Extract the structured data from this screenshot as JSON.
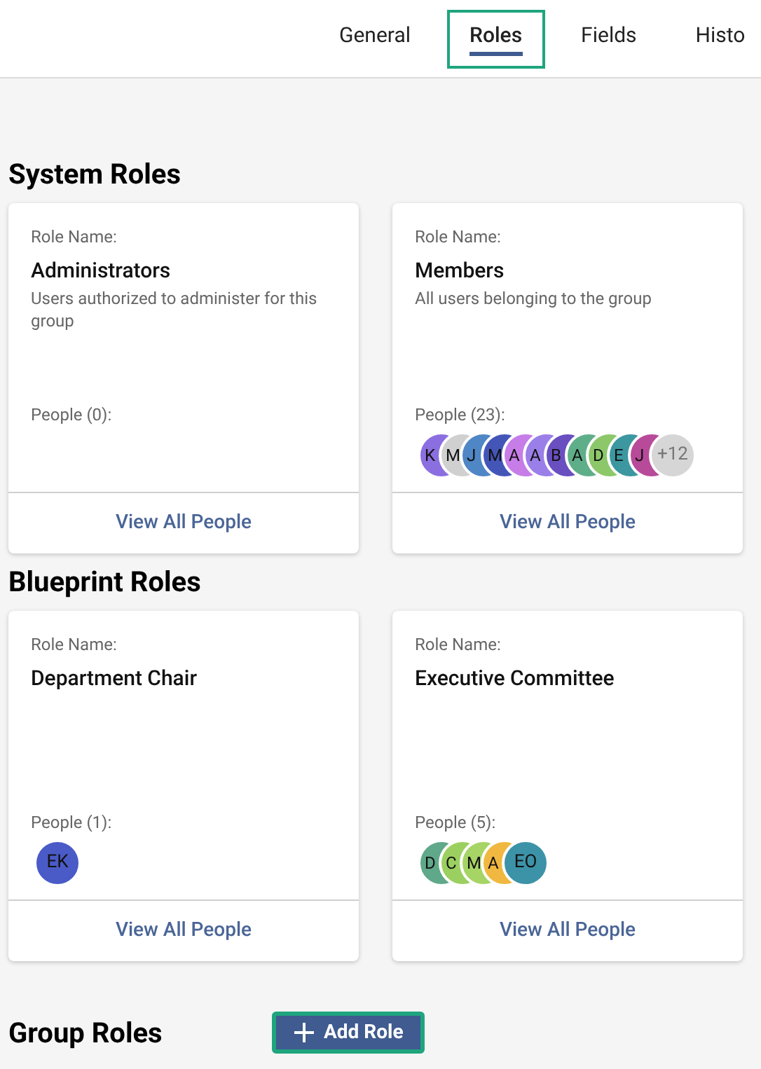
{
  "tabs": [
    {
      "label": "General",
      "selected": false,
      "focused": false
    },
    {
      "label": "Roles",
      "selected": true,
      "focused": true
    },
    {
      "label": "Fields",
      "selected": false,
      "focused": false
    },
    {
      "label": "Histo",
      "selected": false,
      "focused": false
    }
  ],
  "sections": [
    {
      "title": "System Roles",
      "roles": [
        {
          "role_label": "Role Name:",
          "name": "Administrators",
          "description": "Users authorized to administer for this group",
          "people_label": "People (0):",
          "link": "View All People"
        },
        {
          "role_label": "Role Name:",
          "name": "Members",
          "description": "All users belonging to the group",
          "people_label": "People (23):",
          "avatars": [
            {
              "kind": "person",
              "initials": "K",
              "color": "#8b6fe0"
            },
            {
              "kind": "person",
              "initials": "M",
              "color": "#d0d0d0"
            },
            {
              "kind": "person",
              "initials": "J",
              "color": "#4f86c6"
            },
            {
              "kind": "person",
              "initials": "M",
              "color": "#4356b8"
            },
            {
              "kind": "person",
              "initials": "A",
              "color": "#c77de8"
            },
            {
              "kind": "person",
              "initials": "A",
              "color": "#9b7fe8"
            },
            {
              "kind": "person",
              "initials": "B",
              "color": "#6a4fc0"
            },
            {
              "kind": "person",
              "initials": "A",
              "color": "#5fae8a"
            },
            {
              "kind": "person",
              "initials": "D",
              "color": "#8cc86a"
            },
            {
              "kind": "person",
              "initials": "E",
              "color": "#3c97a0"
            },
            {
              "kind": "person",
              "initials": "J",
              "color": "#b84a9a"
            },
            {
              "kind": "more",
              "initials": "+12",
              "color": "#d6d6d6"
            }
          ],
          "link": "View All People"
        }
      ]
    },
    {
      "title": "Blueprint Roles",
      "roles": [
        {
          "role_label": "Role Name:",
          "name": "Department Chair",
          "people_label": "People (1):",
          "avatars": [
            {
              "kind": "person",
              "initials": "EK",
              "color": "#4a5bc8"
            }
          ],
          "link": "View All People"
        },
        {
          "role_label": "Role Name:",
          "name": "Executive Committee",
          "people_label": "People (5):",
          "avatars": [
            {
              "kind": "person",
              "initials": "D",
              "color": "#5fa88a"
            },
            {
              "kind": "person",
              "initials": "C",
              "color": "#9bd060"
            },
            {
              "kind": "person",
              "initials": "M",
              "color": "#a6d465"
            },
            {
              "kind": "person",
              "initials": "A",
              "color": "#f0b840"
            },
            {
              "kind": "person",
              "initials": "EO",
              "color": "#3c93a8"
            }
          ],
          "link": "View All People"
        }
      ]
    }
  ],
  "group_roles": {
    "title": "Group Roles",
    "button": {
      "label": "Add Role",
      "focused": true
    }
  }
}
